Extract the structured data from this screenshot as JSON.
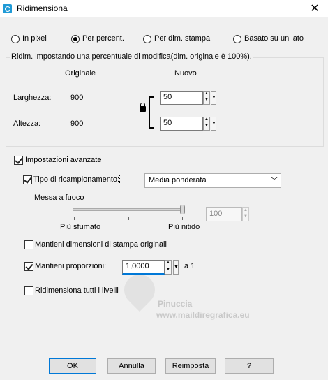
{
  "window": {
    "title": "Ridimensiona",
    "close": "✕"
  },
  "mode": {
    "options": [
      "In pixel",
      "Per percent.",
      "Per dim. stampa",
      "Basato su un lato"
    ],
    "selected": "Per percent."
  },
  "group": {
    "caption": "Ridim. impostando una percentuale di modifica(dim. originale è 100%).",
    "col_original": "Originale",
    "col_new": "Nuovo",
    "width_label": "Larghezza:",
    "width_original": "900",
    "width_new": "50",
    "height_label": "Altezza:",
    "height_original": "900",
    "height_new": "50"
  },
  "advanced": {
    "label": "Impostazioni avanzate",
    "checked": true,
    "resample_label": "Tipo di ricampionamento:",
    "resample_checked": true,
    "resample_value": "Media ponderata",
    "sharpness_label": "Messa a fuoco",
    "sharpness_min_label": "Più sfumato",
    "sharpness_max_label": "Più nitido",
    "sharpness_value": "100",
    "keep_print_label": "Mantieni dimensioni di stampa originali",
    "keep_print_checked": false,
    "keep_ratio_label": "Mantieni proporzioni:",
    "keep_ratio_checked": true,
    "ratio_value": "1,0000",
    "ratio_suffix": "a 1",
    "all_layers_label": "Ridimensiona tutti i livelli",
    "all_layers_checked": false
  },
  "watermark": {
    "name": "Pinuccia",
    "site": "www.maildiregrafica.eu"
  },
  "buttons": {
    "ok": "OK",
    "cancel": "Annulla",
    "reset": "Reimposta",
    "help": "?"
  }
}
